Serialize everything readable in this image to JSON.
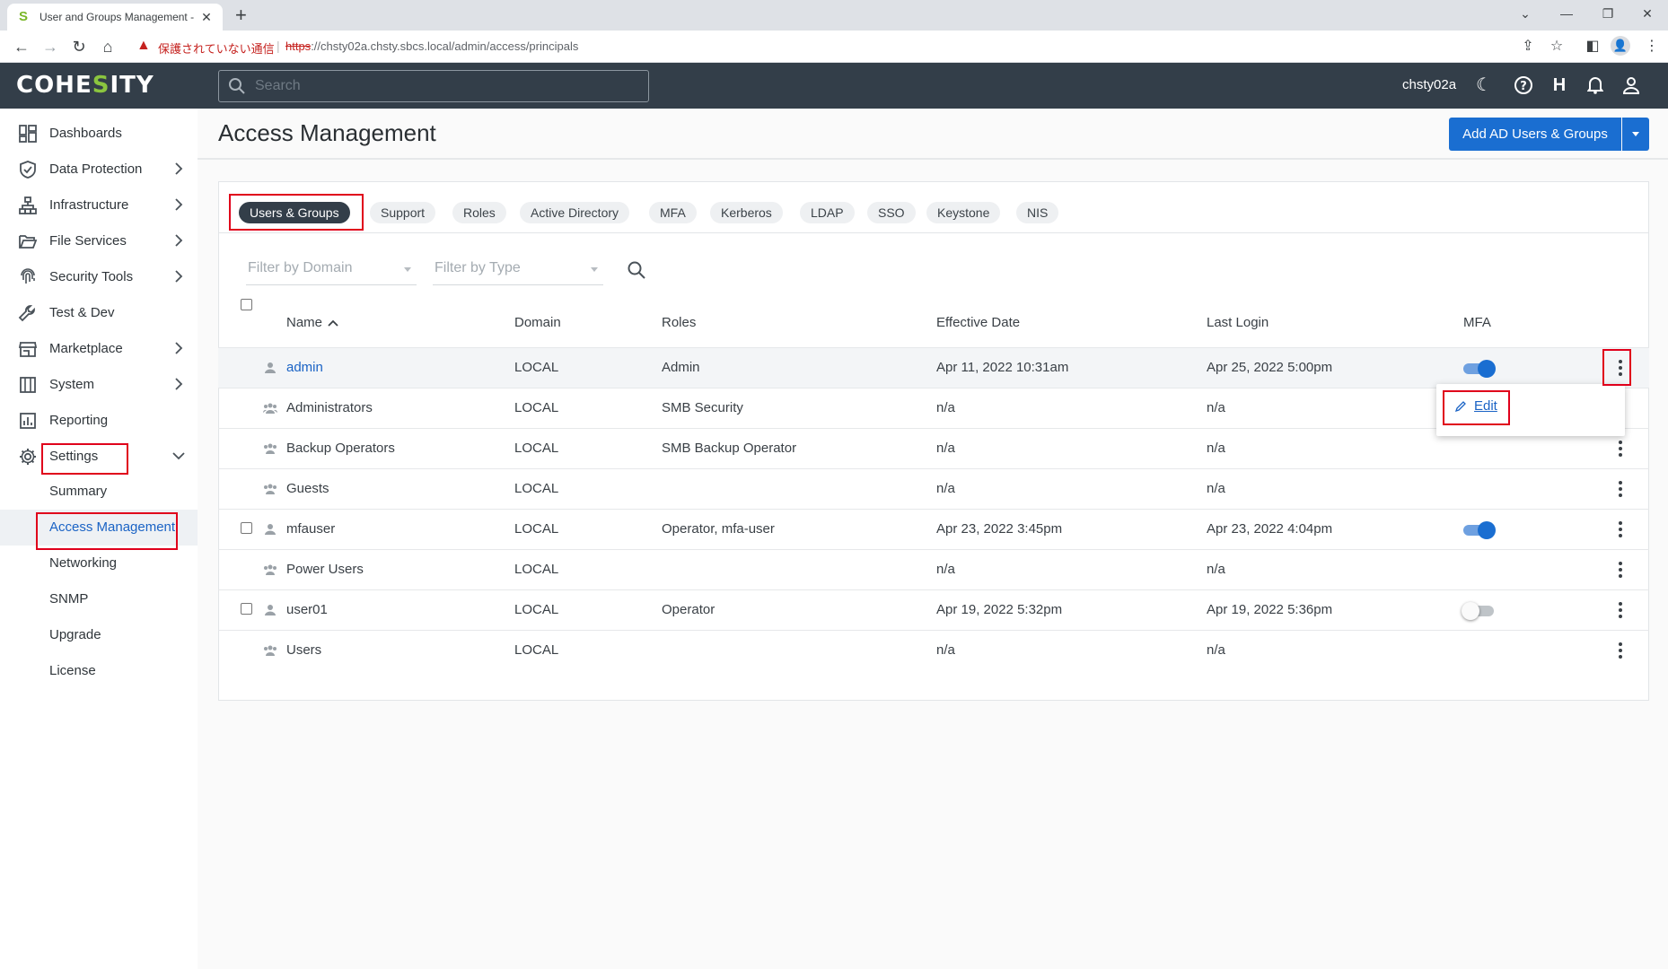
{
  "browser": {
    "tab_title": "User and Groups Management -",
    "insecure_label": "保護されていない通信",
    "url_scheme": "https",
    "url_rest": "://chsty02a.chsty.sbcs.local/admin/access/principals"
  },
  "header": {
    "logo_left": "COHE",
    "logo_mid": "S",
    "logo_right": "ITY",
    "search_placeholder": "Search",
    "username": "chsty02a"
  },
  "sidebar": {
    "items": [
      {
        "label": "Dashboards"
      },
      {
        "label": "Data Protection"
      },
      {
        "label": "Infrastructure"
      },
      {
        "label": "File Services"
      },
      {
        "label": "Security Tools"
      },
      {
        "label": "Test & Dev"
      },
      {
        "label": "Marketplace"
      },
      {
        "label": "System"
      },
      {
        "label": "Reporting"
      },
      {
        "label": "Settings"
      }
    ],
    "settings_sub": [
      "Summary",
      "Access Management",
      "Networking",
      "SNMP",
      "Upgrade",
      "License"
    ]
  },
  "page": {
    "title": "Access Management",
    "add_button": "Add AD Users & Groups"
  },
  "tabs": [
    "Users & Groups",
    "Support",
    "Roles",
    "Active Directory",
    "MFA",
    "Kerberos",
    "LDAP",
    "SSO",
    "Keystone",
    "NIS"
  ],
  "filters": {
    "domain": "Filter by Domain",
    "type": "Filter by Type"
  },
  "columns": {
    "name": "Name",
    "domain": "Domain",
    "roles": "Roles",
    "effective": "Effective Date",
    "last_login": "Last Login",
    "mfa": "MFA"
  },
  "rows": [
    {
      "name": "admin",
      "domain": "LOCAL",
      "roles": "Admin",
      "effective": "Apr 11, 2022 10:31am",
      "last_login": "Apr 25, 2022 5:00pm"
    },
    {
      "name": "Administrators",
      "domain": "LOCAL",
      "roles": "SMB Security",
      "effective": "n/a",
      "last_login": "n/a"
    },
    {
      "name": "Backup Operators",
      "domain": "LOCAL",
      "roles": "SMB Backup Operator",
      "effective": "n/a",
      "last_login": "n/a"
    },
    {
      "name": "Guests",
      "domain": "LOCAL",
      "roles": "",
      "effective": "n/a",
      "last_login": "n/a"
    },
    {
      "name": "mfauser",
      "domain": "LOCAL",
      "roles": "Operator, mfa-user",
      "effective": "Apr 23, 2022 3:45pm",
      "last_login": "Apr 23, 2022 4:04pm"
    },
    {
      "name": "Power Users",
      "domain": "LOCAL",
      "roles": "",
      "effective": "n/a",
      "last_login": "n/a"
    },
    {
      "name": "user01",
      "domain": "LOCAL",
      "roles": "Operator",
      "effective": "Apr 19, 2022 5:32pm",
      "last_login": "Apr 19, 2022 5:36pm"
    },
    {
      "name": "Users",
      "domain": "LOCAL",
      "roles": "",
      "effective": "n/a",
      "last_login": "n/a"
    }
  ],
  "mfa_states": {
    "admin": "on",
    "mfauser": "on",
    "user01": "off"
  },
  "menu": {
    "edit": "Edit"
  },
  "colors": {
    "accent": "#1a6ed1",
    "header_bg": "#333e49",
    "brand_green": "#8bc53f",
    "highlight": "#e0001b"
  }
}
